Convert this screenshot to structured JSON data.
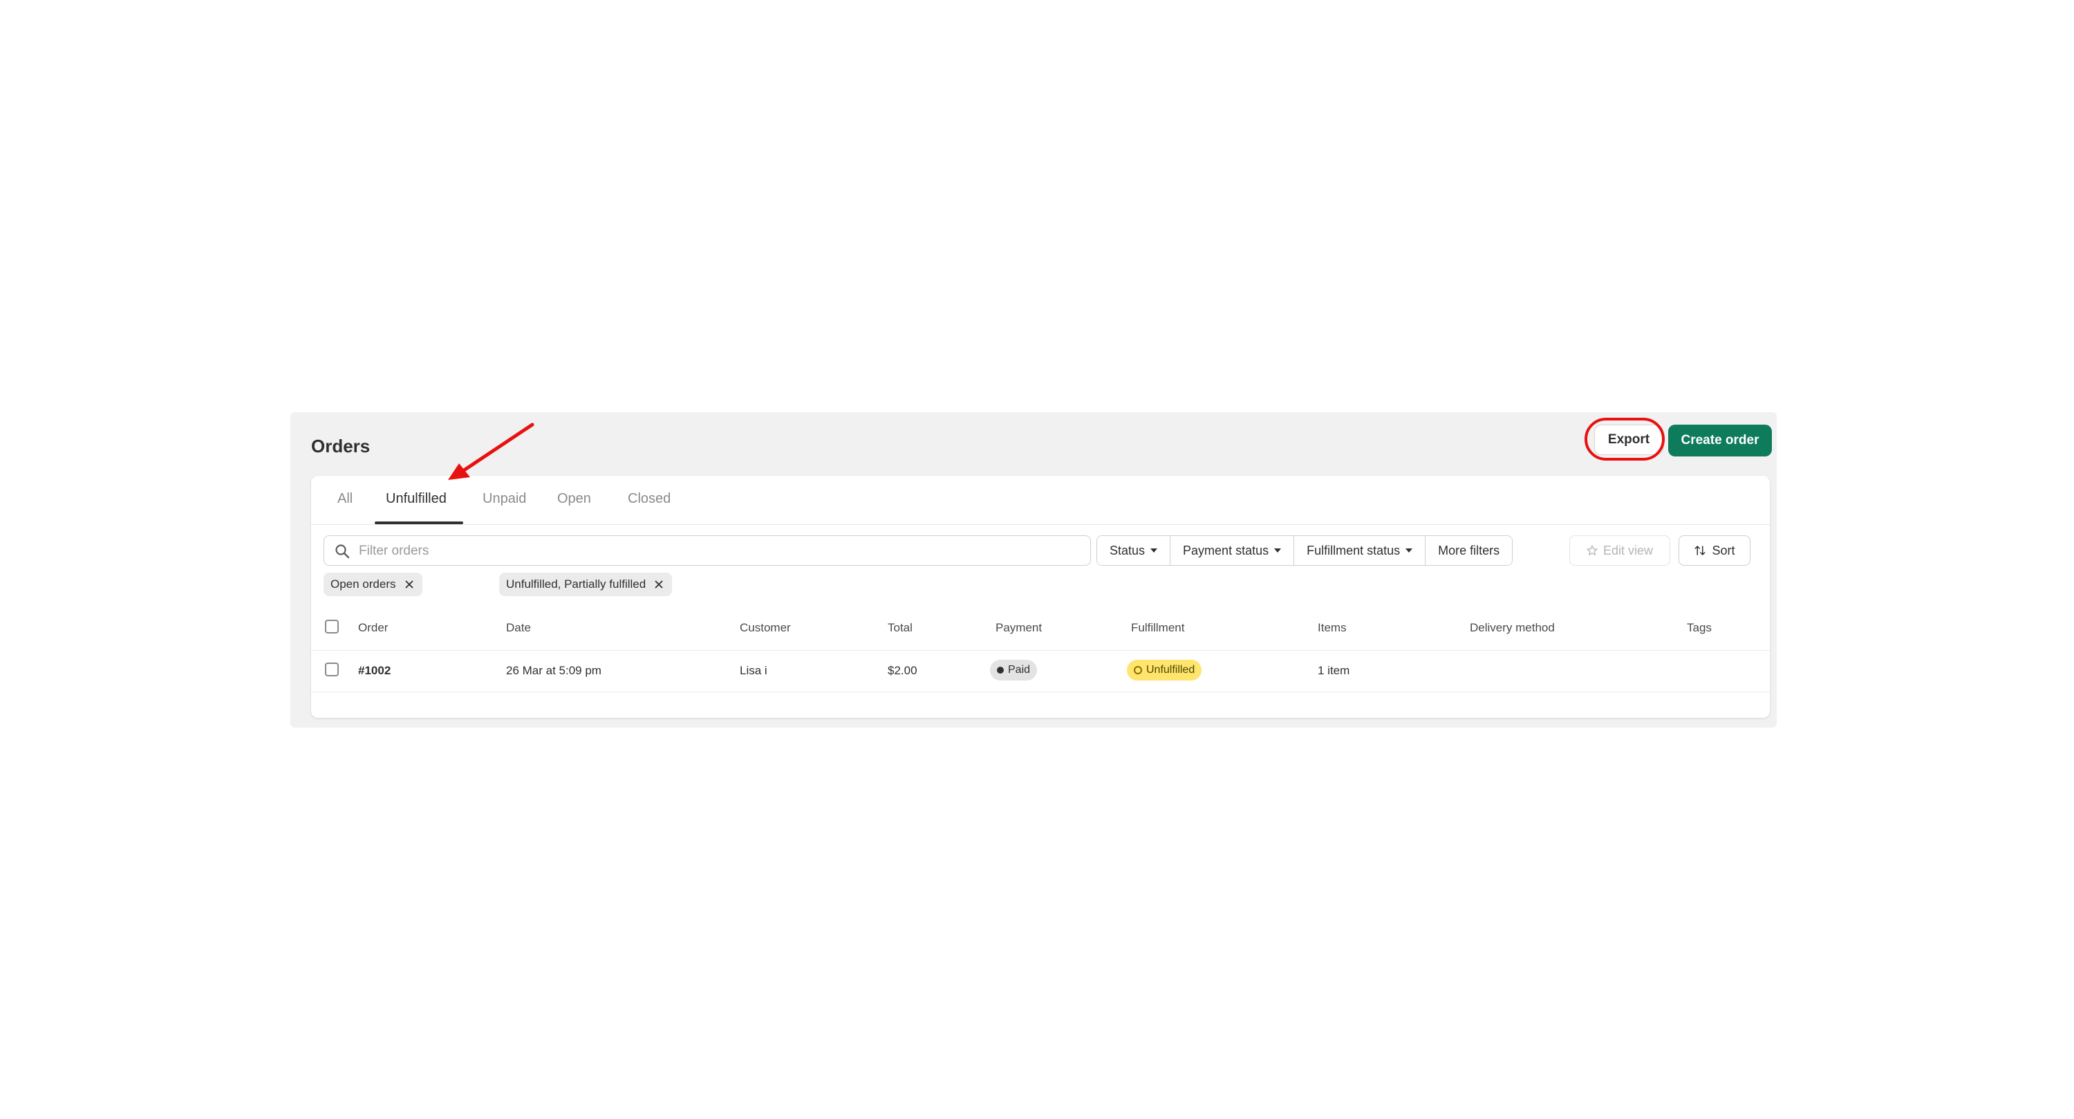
{
  "page": {
    "title": "Orders",
    "export_label": "Export",
    "create_order_label": "Create order",
    "colors": {
      "primary": "#0e7b5a",
      "highlight": "#e8110f",
      "unfulfilled_badge": "#ffe56d",
      "paid_badge": "#e3e3e3"
    }
  },
  "tabs": [
    {
      "label": "All"
    },
    {
      "label": "Unfulfilled",
      "active": true
    },
    {
      "label": "Unpaid"
    },
    {
      "label": "Open"
    },
    {
      "label": "Closed"
    }
  ],
  "search": {
    "placeholder": "Filter orders",
    "icon": "search-icon"
  },
  "filters": [
    {
      "label": "Status"
    },
    {
      "label": "Payment status"
    },
    {
      "label": "Fulfillment status"
    },
    {
      "label": "More filters"
    }
  ],
  "edit_view_label": "Edit view",
  "sort_label": "Sort",
  "applied_filters": [
    {
      "label": "Open orders"
    },
    {
      "label": "Unfulfilled, Partially fulfilled"
    }
  ],
  "table": {
    "columns": [
      "Order",
      "Date",
      "Customer",
      "Total",
      "Payment",
      "Fulfillment",
      "Items",
      "Delivery method",
      "Tags"
    ],
    "rows": [
      {
        "order": "#1002",
        "date": "26 Mar at 5:09 pm",
        "customer": "Lisa i",
        "total": "$2.00",
        "payment": "Paid",
        "fulfillment": "Unfulfilled",
        "items": "1 item",
        "delivery_method": "",
        "tags": ""
      }
    ]
  }
}
